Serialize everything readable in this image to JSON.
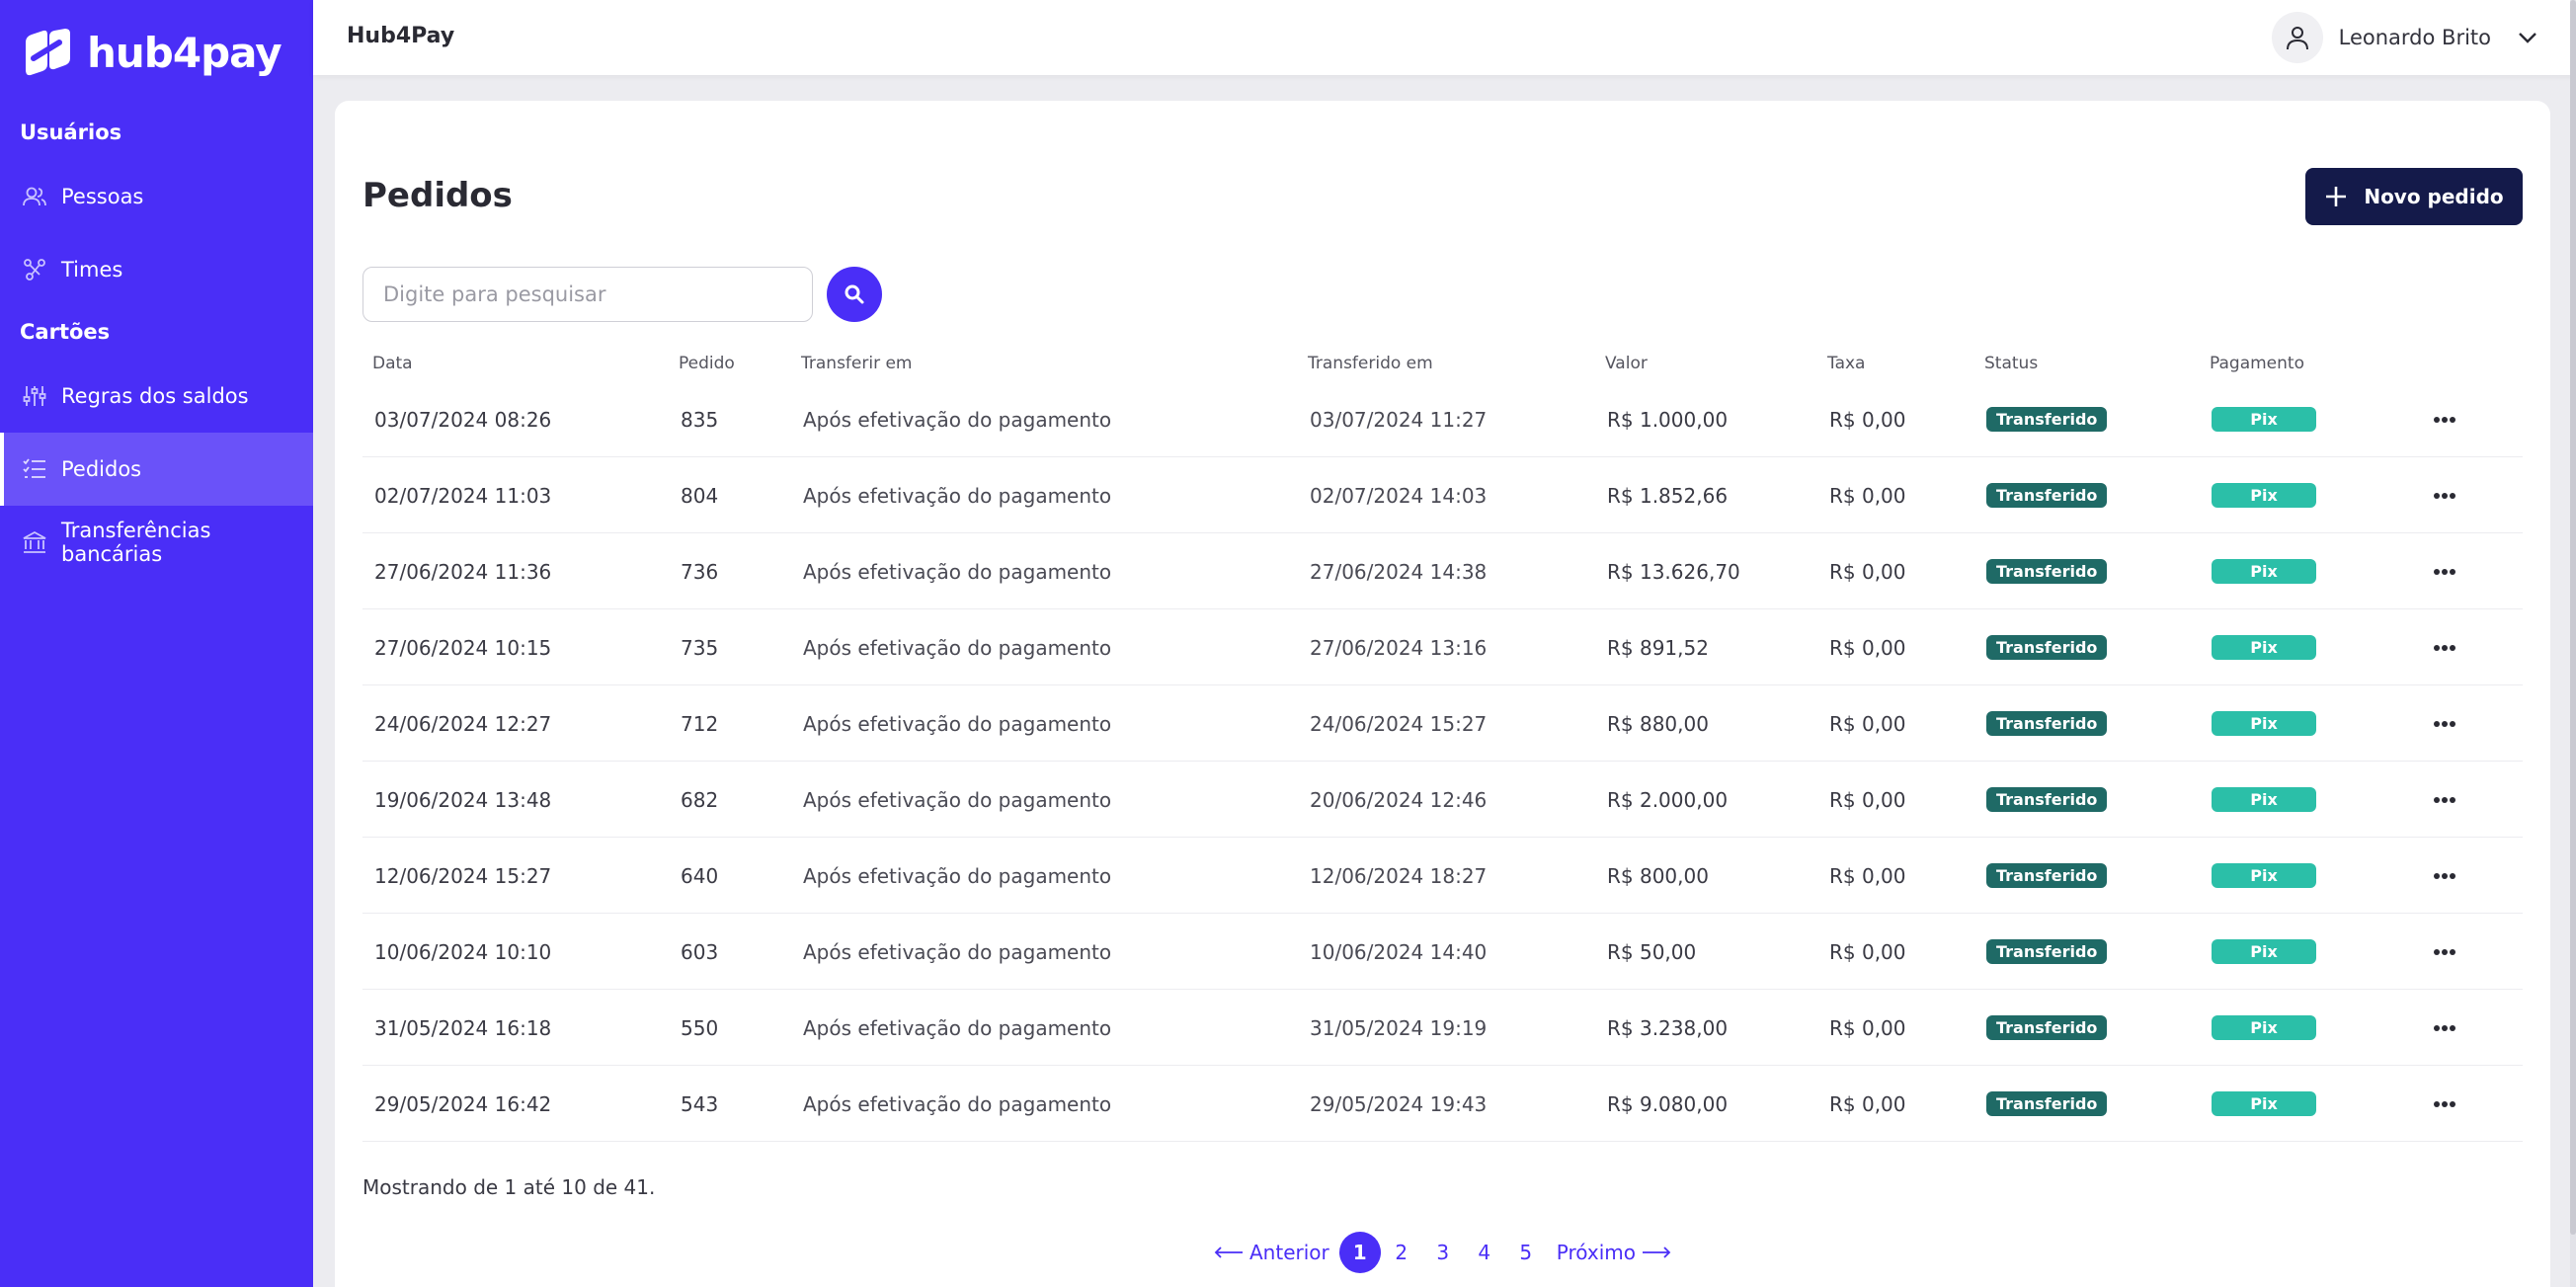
{
  "brand": {
    "name": "hub4pay",
    "accent": "#4a2ef7",
    "dark": "#141a4a"
  },
  "header": {
    "app_title": "Hub4Pay",
    "user_name": "Leonardo Brito"
  },
  "sidebar": {
    "sections": [
      {
        "label": "Usuários",
        "items": [
          {
            "label": "Pessoas",
            "icon": "users-icon"
          },
          {
            "label": "Times",
            "icon": "team-graph-icon"
          }
        ]
      },
      {
        "label": "Cartões",
        "items": [
          {
            "label": "Regras dos saldos",
            "icon": "sliders-icon"
          },
          {
            "label": "Pedidos",
            "icon": "list-check-icon",
            "active": true
          },
          {
            "label": "Transferências bancárias",
            "icon": "bank-icon"
          }
        ]
      }
    ]
  },
  "main": {
    "title": "Pedidos",
    "new_button_label": "Novo pedido",
    "search_placeholder": "Digite para pesquisar",
    "columns": [
      "Data",
      "Pedido",
      "Transferir em",
      "Transferido em",
      "Valor",
      "Taxa",
      "Status",
      "Pagamento"
    ],
    "rows": [
      {
        "data": "03/07/2024 08:26",
        "pedido": "835",
        "transferir": "Após efetivação do pagamento",
        "transferido": "03/07/2024 11:27",
        "valor": "R$ 1.000,00",
        "taxa": "R$ 0,00",
        "status": "Transferido",
        "pagamento": "Pix"
      },
      {
        "data": "02/07/2024 11:03",
        "pedido": "804",
        "transferir": "Após efetivação do pagamento",
        "transferido": "02/07/2024 14:03",
        "valor": "R$ 1.852,66",
        "taxa": "R$ 0,00",
        "status": "Transferido",
        "pagamento": "Pix"
      },
      {
        "data": "27/06/2024 11:36",
        "pedido": "736",
        "transferir": "Após efetivação do pagamento",
        "transferido": "27/06/2024 14:38",
        "valor": "R$ 13.626,70",
        "taxa": "R$ 0,00",
        "status": "Transferido",
        "pagamento": "Pix"
      },
      {
        "data": "27/06/2024 10:15",
        "pedido": "735",
        "transferir": "Após efetivação do pagamento",
        "transferido": "27/06/2024 13:16",
        "valor": "R$ 891,52",
        "taxa": "R$ 0,00",
        "status": "Transferido",
        "pagamento": "Pix"
      },
      {
        "data": "24/06/2024 12:27",
        "pedido": "712",
        "transferir": "Após efetivação do pagamento",
        "transferido": "24/06/2024 15:27",
        "valor": "R$ 880,00",
        "taxa": "R$ 0,00",
        "status": "Transferido",
        "pagamento": "Pix"
      },
      {
        "data": "19/06/2024 13:48",
        "pedido": "682",
        "transferir": "Após efetivação do pagamento",
        "transferido": "20/06/2024 12:46",
        "valor": "R$ 2.000,00",
        "taxa": "R$ 0,00",
        "status": "Transferido",
        "pagamento": "Pix"
      },
      {
        "data": "12/06/2024 15:27",
        "pedido": "640",
        "transferir": "Após efetivação do pagamento",
        "transferido": "12/06/2024 18:27",
        "valor": "R$ 800,00",
        "taxa": "R$ 0,00",
        "status": "Transferido",
        "pagamento": "Pix"
      },
      {
        "data": "10/06/2024 10:10",
        "pedido": "603",
        "transferir": "Após efetivação do pagamento",
        "transferido": "10/06/2024 14:40",
        "valor": "R$ 50,00",
        "taxa": "R$ 0,00",
        "status": "Transferido",
        "pagamento": "Pix"
      },
      {
        "data": "31/05/2024 16:18",
        "pedido": "550",
        "transferir": "Após efetivação do pagamento",
        "transferido": "31/05/2024 19:19",
        "valor": "R$ 3.238,00",
        "taxa": "R$ 0,00",
        "status": "Transferido",
        "pagamento": "Pix"
      },
      {
        "data": "29/05/2024 16:42",
        "pedido": "543",
        "transferir": "Após efetivação do pagamento",
        "transferido": "29/05/2024 19:43",
        "valor": "R$ 9.080,00",
        "taxa": "R$ 0,00",
        "status": "Transferido",
        "pagamento": "Pix"
      }
    ],
    "summary": "Mostrando de 1 até 10 de 41.",
    "pagination": {
      "prev_label": "Anterior",
      "next_label": "Próximo",
      "pages": [
        "1",
        "2",
        "3",
        "4",
        "5"
      ],
      "current": "1"
    }
  }
}
